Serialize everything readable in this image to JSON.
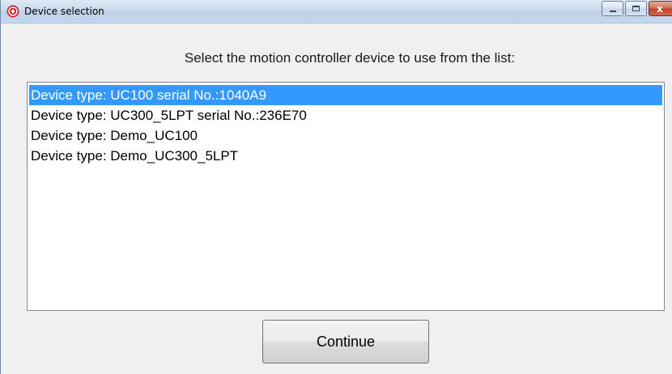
{
  "window": {
    "title": "Device selection",
    "icon": "app-icon",
    "controls": {
      "minimize_icon": "minimize-icon",
      "maximize_icon": "maximize-icon",
      "close_glyph": "x"
    }
  },
  "prompt": "Select the motion controller device to use from the list:",
  "device_list": {
    "items": [
      {
        "label": "Device type: UC100 serial No.:1040A9",
        "selected": true
      },
      {
        "label": "Device type: UC300_5LPT serial No.:236E70",
        "selected": false
      },
      {
        "label": "Device type: Demo_UC100",
        "selected": false
      },
      {
        "label": "Device type: Demo_UC300_5LPT",
        "selected": false
      }
    ]
  },
  "buttons": {
    "continue_label": "Continue"
  },
  "colors": {
    "selection": "#3399ff",
    "app_icon": "#d11f28",
    "close_button": "#c4432a"
  }
}
